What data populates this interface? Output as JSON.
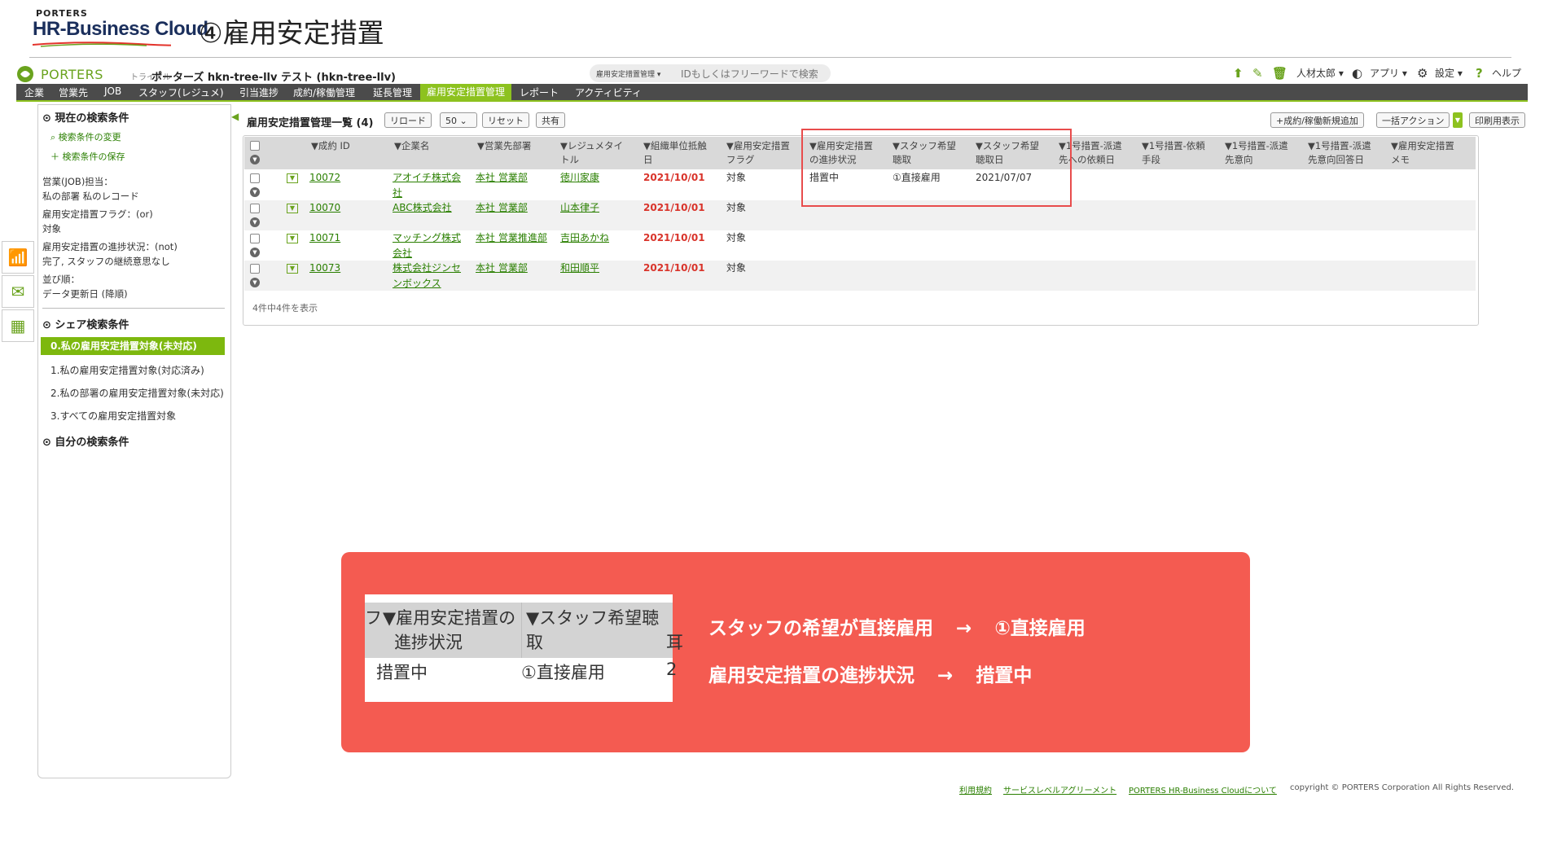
{
  "slide": {
    "brand_small": "PORTERS",
    "brand_big": "HR-Business Cloud",
    "title": "④雇用安定措置"
  },
  "topbar": {
    "logo_text": "PORTERS",
    "trial_label": "トライアル",
    "company_name": "ポーターズ hkn-tree-llv テスト (hkn-tree-llv)",
    "search_scope": "雇用安定措置管理 ▾",
    "search_placeholder": "IDもしくはフリーワードで検索",
    "user_label": "人材太郎 ▾",
    "apps_label": "アプリ ▾",
    "settings_label": "設定 ▾",
    "help_label": "ヘルプ"
  },
  "nav": [
    "企業",
    "営業先",
    "JOB",
    "スタッフ(レジュメ)",
    "引当進捗",
    "成約/稼働管理",
    "延長管理",
    "雇用安定措置管理",
    "レポート",
    "アクティビティ"
  ],
  "nav_active_index": 7,
  "sidebar": {
    "current_conditions_title": "現在の検索条件",
    "change_conditions": "検索条件の変更",
    "save_conditions": "検索条件の保存",
    "conditions": [
      "営業(JOB)担当：",
      "私の部署 私のレコード",
      "雇用安定措置フラグ：(or)",
      "対象",
      "雇用安定措置の進捗状況：(not)",
      "完了, スタッフの継続意思なし",
      "並び順：",
      "データ更新日 (降順)"
    ],
    "share_title": "シェア検索条件",
    "share_items": [
      "0.私の雇用安定措置対象(未対応)",
      "1.私の雇用安定措置対象(対応済み)",
      "2.私の部署の雇用安定措置対象(未対応)",
      "3.すべての雇用安定措置対象"
    ],
    "own_title": "自分の検索条件"
  },
  "list": {
    "title": "雇用安定措置管理一覧 (4)",
    "reload": "リロード",
    "page_size": "50",
    "reset": "リセット",
    "share": "共有",
    "add": "+成約/稼働新規追加",
    "bulk": "一括アクション",
    "print": "印刷用表示",
    "count_text": "4件中4件を表示"
  },
  "table": {
    "headers": [
      [
        "▼成約 ID",
        ""
      ],
      [
        "▼企業名",
        ""
      ],
      [
        "▼営業先部署",
        ""
      ],
      [
        "▼レジュメタイ",
        "トル"
      ],
      [
        "▼組織単位抵触",
        "日"
      ],
      [
        "▼雇用安定措置",
        "フラグ"
      ],
      [
        "▼雇用安定措置",
        "の進捗状況"
      ],
      [
        "▼スタッフ希望",
        "聴取"
      ],
      [
        "▼スタッフ希望",
        "聴取日"
      ],
      [
        "▼1号措置-派遣",
        "先への依頼日"
      ],
      [
        "▼1号措置-依頼",
        "手段"
      ],
      [
        "▼1号措置-派遣",
        "先意向"
      ],
      [
        "▼1号措置-派遣",
        "先意向回答日"
      ],
      [
        "▼雇用安定措置",
        "メモ"
      ]
    ],
    "rows": [
      {
        "id": "10072",
        "company": "アオイチ株式会",
        "company2": "社",
        "dept": "本社 営業部",
        "resume": "徳川家康",
        "date": "2021/10/01",
        "flag": "対象",
        "status": "措置中",
        "hearing": "①直接雇用",
        "hearing_date": "2021/07/07"
      },
      {
        "id": "10070",
        "company": "ABC株式会社",
        "company2": "",
        "dept": "本社 営業部",
        "resume": "山本律子",
        "date": "2021/10/01",
        "flag": "対象",
        "status": "",
        "hearing": "",
        "hearing_date": ""
      },
      {
        "id": "10071",
        "company": "マッチング株式",
        "company2": "会社",
        "dept": "本社 営業推進部",
        "resume": "吉田あかね",
        "date": "2021/10/01",
        "flag": "対象",
        "status": "",
        "hearing": "",
        "hearing_date": ""
      },
      {
        "id": "10073",
        "company": "株式会社ジンセ",
        "company2": "ンボックス",
        "dept": "本社 営業部",
        "resume": "和田順平",
        "date": "2021/10/01",
        "flag": "対象",
        "status": "",
        "hearing": "",
        "hearing_date": ""
      }
    ]
  },
  "footer": {
    "terms": "利用規約",
    "sla": "サービスレベルアグリーメント",
    "about": "PORTERS HR-Business Cloudについて",
    "copyright": "copyright © PORTERS Corporation All Rights Reserved."
  },
  "callout": {
    "zoom_lead_char": "フ",
    "zoom_header1_line1": "▼雇用安定措置の",
    "zoom_header1_line2": "進捗状況",
    "zoom_header2_line1": "▼スタッフ希望聴",
    "zoom_header2_line2": "取",
    "zoom_header3": "耳",
    "zoom_value1": "措置中",
    "zoom_value2": "①直接雇用",
    "zoom_value3": "2",
    "line1_left": "スタッフの希望が直接雇用",
    "line1_arrow": "→",
    "line1_right": "①直接雇用",
    "line2_left": "雇用安定措置の進捗状況",
    "line2_arrow": "→",
    "line2_right": "措置中"
  },
  "colors": {
    "accent": "#8dc21f",
    "nav_bg": "#4b4b4b",
    "callout": "#f45b51",
    "highlight": "#e84c4c",
    "date_red": "#d9342b"
  }
}
